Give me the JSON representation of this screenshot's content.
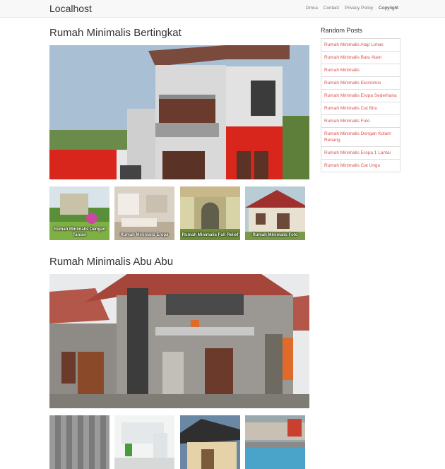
{
  "navbar": {
    "brand": "Localhost",
    "links": [
      "Dmca",
      "Contact",
      "Privacy Policy",
      "Copyright"
    ]
  },
  "posts": [
    {
      "title": "Rumah Minimalis Bertingkat",
      "thumbs": [
        {
          "caption": "Rumah Minimalis Dengan Taman"
        },
        {
          "caption": "Rumah Minimalis Eropa"
        },
        {
          "caption": "Rumah Minimalis Full Relief"
        },
        {
          "caption": "Rumah Minimalis Foto"
        }
      ]
    },
    {
      "title": "Rumah Minimalis Abu Abu",
      "thumbs": [
        {
          "caption": ""
        },
        {
          "caption": ""
        },
        {
          "caption": ""
        },
        {
          "caption": ""
        }
      ]
    }
  ],
  "sidebar": {
    "title": "Random Posts",
    "items": [
      "Rumah Minimalis Atap Limas",
      "Rumah Minimalis Batu Alam",
      "Rumah Minimalis",
      "Rumah Minimalis Ekonomis",
      "Rumah Minimalis Eropa Sederhana",
      "Rumah Minimalis Cat Biru",
      "Rumah Minimalis Foto",
      "Rumah Minimalis Dengan Kolam Renang",
      "Rumah Minimalis Eropa 1 Lantai",
      "Rumah Minimalis Cat Ungu"
    ]
  }
}
